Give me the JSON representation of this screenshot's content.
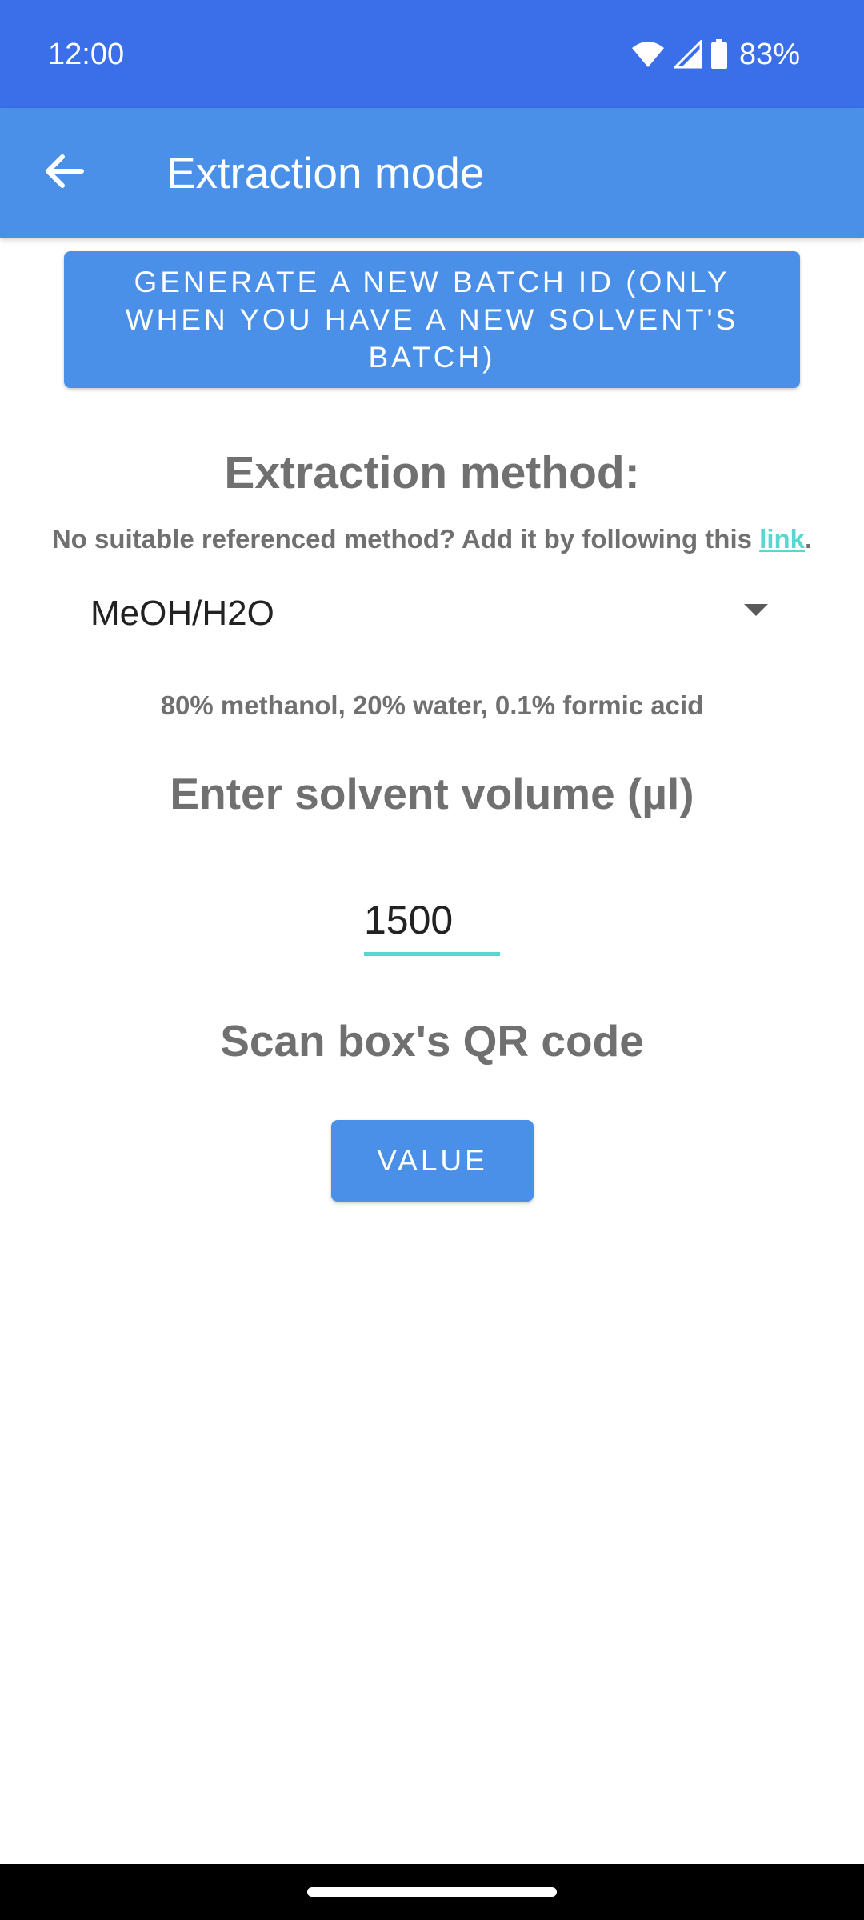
{
  "status_bar": {
    "time": "12:00",
    "battery": "83%",
    "icons": [
      "wifi-icon",
      "cell-signal-icon",
      "battery-icon"
    ]
  },
  "app_bar": {
    "title": "Extraction mode",
    "back_icon": "arrow-left-icon"
  },
  "batch_button": {
    "label": "GENERATE A  NEW BATCH ID (ONLY WHEN YOU HAVE A NEW SOLVENT'S BATCH)"
  },
  "method": {
    "heading": "Extraction method:",
    "hint_prefix": "No suitable referenced method? Add it by following this ",
    "hint_link": "link",
    "hint_suffix": ".",
    "selected": "MeOH/H2O",
    "description": "80% methanol, 20% water, 0.1% formic acid"
  },
  "volume": {
    "heading": "Enter solvent volume (µl)",
    "value": "1500"
  },
  "scan": {
    "heading": "Scan box's QR code",
    "button_label": "VALUE"
  },
  "colors": {
    "status_bar": "#3b6fea",
    "app_bar": "#4a90e8",
    "button": "#4a90e8",
    "link": "#58d6d0",
    "input_underline": "#58d6d0",
    "heading_text": "#707070"
  }
}
